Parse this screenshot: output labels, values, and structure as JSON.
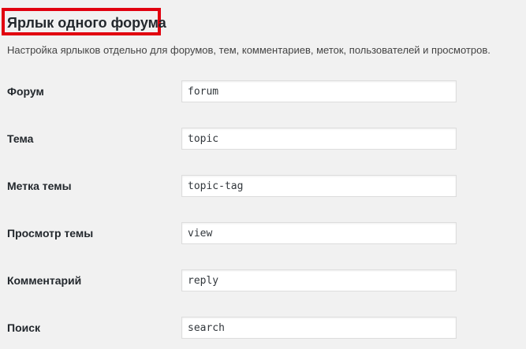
{
  "section": {
    "title": "Ярлык одного форума",
    "description": "Настройка ярлыков отдельно для форумов, тем, комментариев, меток, пользователей и просмотров."
  },
  "fields": [
    {
      "label": "Форум",
      "value": "forum"
    },
    {
      "label": "Тема",
      "value": "topic"
    },
    {
      "label": "Метка темы",
      "value": "topic-tag"
    },
    {
      "label": "Просмотр темы",
      "value": "view"
    },
    {
      "label": "Комментарий",
      "value": "reply"
    },
    {
      "label": "Поиск",
      "value": "search"
    }
  ],
  "colors": {
    "highlight_border": "#e1000f",
    "background": "#f1f1f1"
  }
}
